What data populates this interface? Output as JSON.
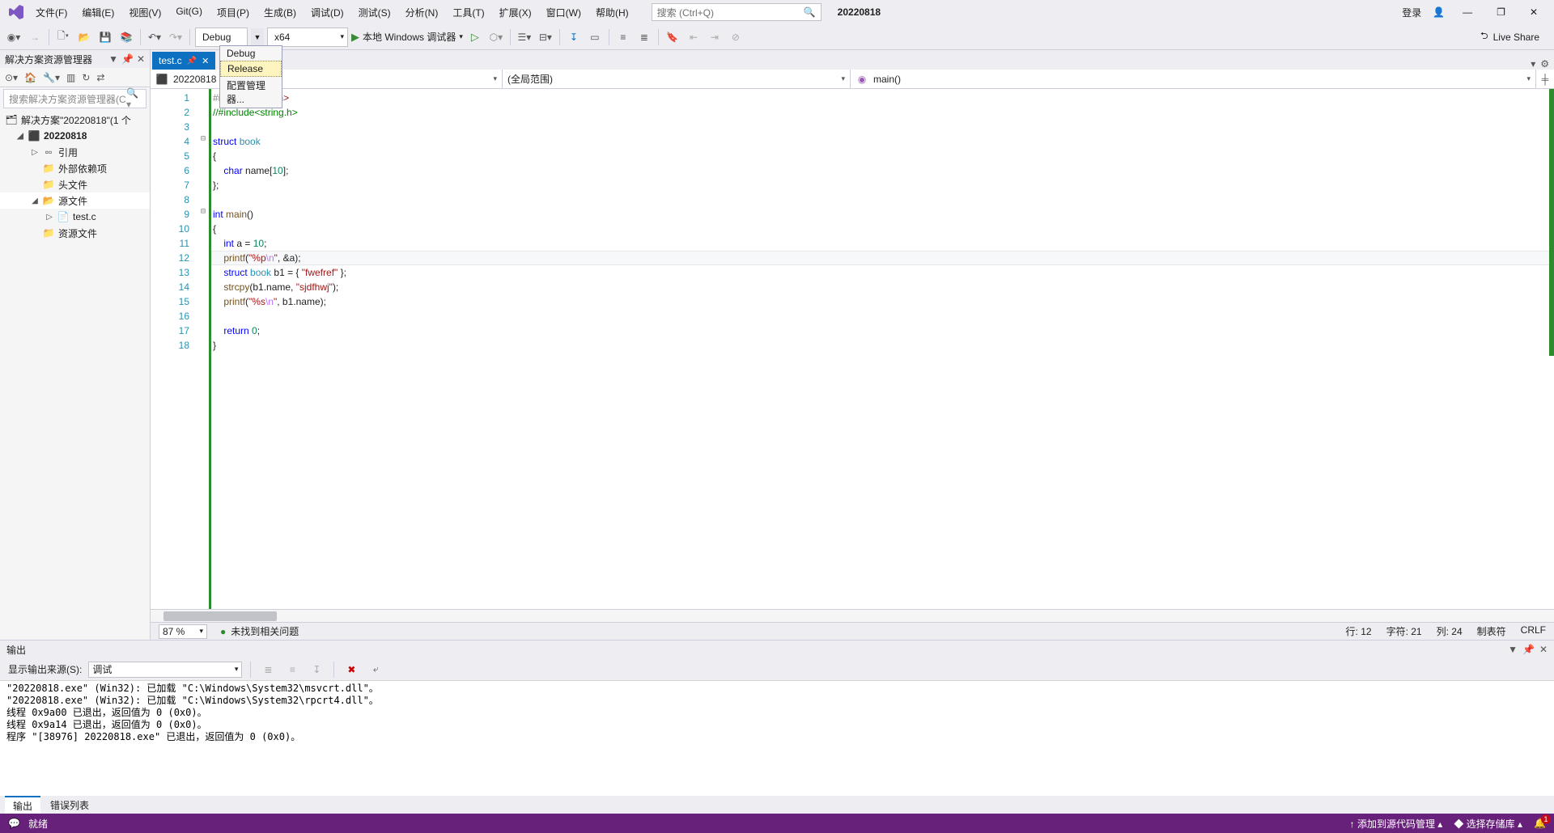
{
  "menubar": {
    "items": [
      "文件(F)",
      "编辑(E)",
      "视图(V)",
      "Git(G)",
      "项目(P)",
      "生成(B)",
      "调试(D)",
      "测试(S)",
      "分析(N)",
      "工具(T)",
      "扩展(X)",
      "窗口(W)",
      "帮助(H)"
    ],
    "search_placeholder": "搜索 (Ctrl+Q)",
    "project_label": "20220818",
    "login": "登录",
    "win_min": "—",
    "win_max": "❐",
    "win_close": "✕"
  },
  "toolbar": {
    "config_value": "Debug",
    "config_options": [
      "Debug",
      "Release"
    ],
    "config_mgr": "配置管理器...",
    "platform_value": "x64",
    "debugger_label": "本地 Windows 调试器",
    "liveshare": "Live Share"
  },
  "solution": {
    "title": "解决方案资源管理器",
    "search_placeholder": "搜索解决方案资源管理器(Ctrl+;)",
    "root": "解决方案\"20220818\"(1 个",
    "project": "20220818",
    "refs": "引用",
    "ext_deps": "外部依赖项",
    "headers": "头文件",
    "sources": "源文件",
    "file1": "test.c",
    "resources": "资源文件"
  },
  "editor": {
    "tab": "test.c",
    "nav_project": "20220818",
    "nav_scope": "(全局范围)",
    "nav_member": "main()",
    "zoom": "87 %",
    "no_issues": "未找到相关问题",
    "line": "行: 12",
    "char": "字符: 21",
    "col": "列: 24",
    "tabs_spaces": "制表符",
    "crlf": "CRLF",
    "line_numbers": [
      "1",
      "2",
      "3",
      "4",
      "5",
      "6",
      "7",
      "8",
      "9",
      "10",
      "11",
      "12",
      "13",
      "14",
      "15",
      "16",
      "17",
      "18"
    ],
    "fold": [
      "",
      "",
      "",
      "⊟",
      "",
      "",
      "",
      "",
      "⊟",
      "",
      "",
      "",
      "",
      "",
      "",
      "",
      "",
      ""
    ],
    "code": [
      {
        "pre": "",
        "html": "<span class='pp'>#include</span><span class='str'>&lt;stdio.h&gt;</span>"
      },
      {
        "pre": "",
        "html": "<span class='cm'>//#include&lt;string.h&gt;</span>"
      },
      {
        "pre": "",
        "html": ""
      },
      {
        "pre": "",
        "html": "<span class='kw'>struct</span> <span class='typ'>book</span>"
      },
      {
        "pre": "",
        "html": "{"
      },
      {
        "pre": "    ",
        "html": "<span class='kw'>char</span> name[<span class='num'>10</span>];"
      },
      {
        "pre": "",
        "html": "};"
      },
      {
        "pre": "",
        "html": ""
      },
      {
        "pre": "",
        "html": "<span class='kw'>int</span> <span class='fn'>main</span>()"
      },
      {
        "pre": "",
        "html": "{"
      },
      {
        "pre": "    ",
        "html": "<span class='kw'>int</span> a = <span class='num'>10</span>;"
      },
      {
        "pre": "    ",
        "html": "<span class='fn'>printf</span>(<span class='str'>\"%p<span class='esc'>\\n</span>\"</span>, &amp;a);",
        "cur": true
      },
      {
        "pre": "    ",
        "html": "<span class='kw'>struct</span> <span class='typ'>book</span> b1 = { <span class='str'>\"fwefref\"</span> };"
      },
      {
        "pre": "    ",
        "html": "<span class='fn'>strcpy</span>(b1.name, <span class='str'>\"sjdfhwj\"</span>);"
      },
      {
        "pre": "    ",
        "html": "<span class='fn'>printf</span>(<span class='str'>\"%s<span class='esc'>\\n</span>\"</span>, b1.name);"
      },
      {
        "pre": "",
        "html": ""
      },
      {
        "pre": "    ",
        "html": "<span class='kw'>return</span> <span class='num'>0</span>;"
      },
      {
        "pre": "",
        "html": "}"
      }
    ]
  },
  "output": {
    "title": "输出",
    "source_label": "显示输出来源(S):",
    "source_value": "调试",
    "text": "\"20220818.exe\" (Win32): 已加载 \"C:\\Windows\\System32\\msvcrt.dll\"。\n\"20220818.exe\" (Win32): 已加载 \"C:\\Windows\\System32\\rpcrt4.dll\"。\n线程 0x9a00 已退出，返回值为 0 (0x0)。\n线程 0x9a14 已退出，返回值为 0 (0x0)。\n程序 \"[38976] 20220818.exe\" 已退出，返回值为 0 (0x0)。",
    "tabs": [
      "输出",
      "错误列表"
    ]
  },
  "status": {
    "ready": "就绪",
    "src_ctrl": "添加到源代码管理",
    "repo": "选择存储库",
    "bell_count": "1"
  }
}
